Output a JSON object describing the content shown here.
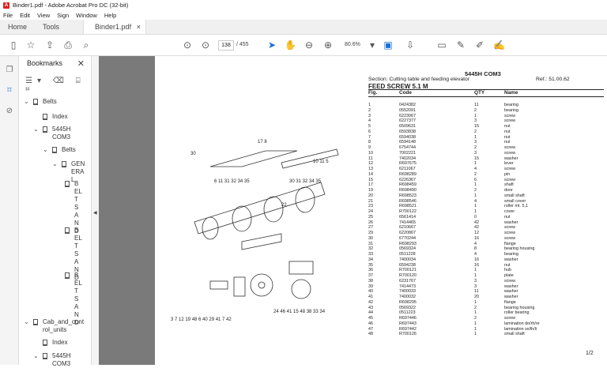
{
  "window": {
    "title": "Binder1.pdf - Adobe Acrobat Pro DC (32-bit)"
  },
  "menu": [
    "File",
    "Edit",
    "View",
    "Sign",
    "Window",
    "Help"
  ],
  "tabs": {
    "home": "Home",
    "tools": "Tools",
    "doc": "Binder1.pdf",
    "close": "×"
  },
  "toolbar": {
    "page_current": "138",
    "page_total": "/ 455",
    "zoom": "80.6%"
  },
  "bookmarks": {
    "title": "Bookmarks",
    "close": "✕",
    "tree": [
      {
        "label": "Belts"
      },
      {
        "label": "Index"
      },
      {
        "label": "5445H COM3"
      },
      {
        "label": "Belts"
      },
      {
        "label": "GENERAL"
      },
      {
        "label": "BELTS AND"
      },
      {
        "label": "BELTS AND"
      },
      {
        "label": "BELTS AND"
      },
      {
        "label": "Cab_and_control_units"
      },
      {
        "label": "Index"
      },
      {
        "label": "5445H COM3"
      }
    ]
  },
  "page": {
    "title": "5445H COM3",
    "section": "Section: Cutting table and feeding elevator",
    "ref": "Ref.: 51.00.62",
    "heading": "FEED SCREW 5.1 M",
    "columns": [
      "Fig.",
      "Code",
      "QTY",
      "Name"
    ],
    "rows": [
      [
        "1",
        "0424382",
        "11",
        "bearing"
      ],
      [
        "2",
        "0552091",
        "2",
        "bearing"
      ],
      [
        "3",
        "6223067",
        "1",
        "screw"
      ],
      [
        "4",
        "6227377",
        "3",
        "screw"
      ],
      [
        "5",
        "6509631",
        "15",
        "nut"
      ],
      [
        "6",
        "6593838",
        "2",
        "nut"
      ],
      [
        "7",
        "6594038",
        "1",
        "nut"
      ],
      [
        "8",
        "6594148",
        "3",
        "nut"
      ],
      [
        "9",
        "6754744",
        "2",
        "screw"
      ],
      [
        "10",
        "7002221",
        "3",
        "screw"
      ],
      [
        "11",
        "7402034",
        "15",
        "washer"
      ],
      [
        "12",
        "R697675",
        "1",
        "lever"
      ],
      [
        "13",
        "6211067",
        "4",
        "screw"
      ],
      [
        "14",
        "R698289",
        "2",
        "pin"
      ],
      [
        "15",
        "6226367",
        "6",
        "screw"
      ],
      [
        "17",
        "R698459",
        "1",
        "shaft"
      ],
      [
        "19",
        "R698490",
        "2",
        "door"
      ],
      [
        "20",
        "R698523",
        "1",
        "small shaft"
      ],
      [
        "21",
        "R698546",
        "4",
        "small cover"
      ],
      [
        "23",
        "R698521",
        "1",
        "roller mt. 5,1"
      ],
      [
        "24",
        "R700122",
        "1",
        "cover"
      ],
      [
        "25",
        "6561414",
        "0",
        "nut"
      ],
      [
        "26",
        "7414465",
        "42",
        "washer"
      ],
      [
        "27",
        "6210667",
        "42",
        "screw"
      ],
      [
        "29",
        "6220867",
        "12",
        "screw"
      ],
      [
        "30",
        "6770244",
        "16",
        "screw"
      ],
      [
        "31",
        "R698293",
        "4",
        "flange"
      ],
      [
        "32",
        "0569324",
        "8",
        "bearing housing"
      ],
      [
        "33",
        "0511228",
        "4",
        "bearing"
      ],
      [
        "34",
        "7400034",
        "16",
        "washer"
      ],
      [
        "35",
        "6594238",
        "16",
        "nut"
      ],
      [
        "36",
        "R700121",
        "1",
        "hub"
      ],
      [
        "37",
        "R700120",
        "1",
        "plate"
      ],
      [
        "38",
        "6231767",
        "3",
        "screw"
      ],
      [
        "39",
        "7414473",
        "3",
        "washer"
      ],
      [
        "40",
        "7400033",
        "11",
        "washer"
      ],
      [
        "41",
        "7400032",
        "20",
        "washer"
      ],
      [
        "42",
        "R698295",
        "1",
        "flange"
      ],
      [
        "43",
        "0569322",
        "2",
        "bearing housing"
      ],
      [
        "44",
        "0511223",
        "1",
        "roller bearing"
      ],
      [
        "45",
        "R697446",
        "2",
        "screw"
      ],
      [
        "46",
        "R697443",
        "1",
        "lamination do/rh/re"
      ],
      [
        "47",
        "R697442",
        "1",
        "lamination sx/lh/li"
      ],
      [
        "48",
        "R700126",
        "1",
        "small shaft"
      ]
    ],
    "page_number": "1/2"
  }
}
